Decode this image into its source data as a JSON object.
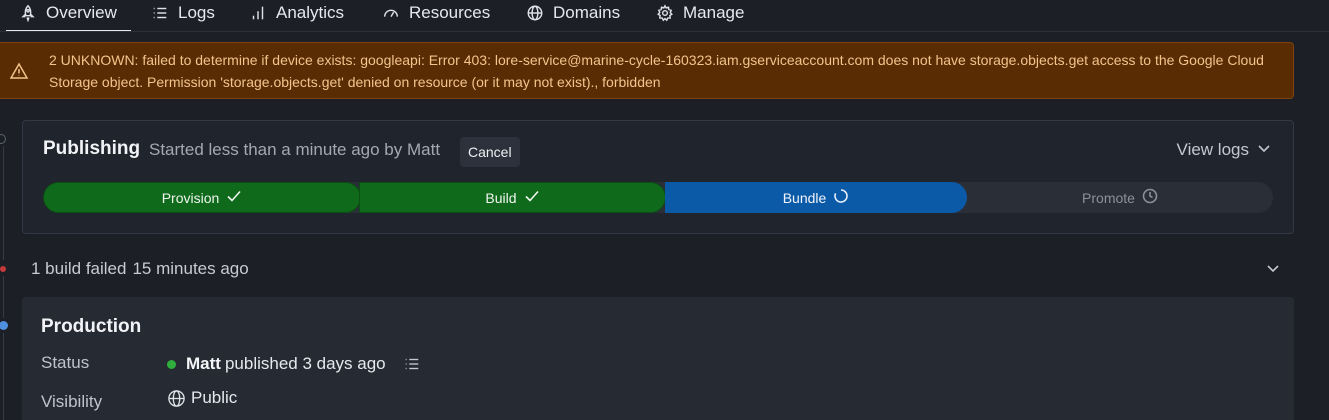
{
  "nav": {
    "tabs": [
      {
        "label": "Overview",
        "icon": "rocket-icon",
        "active": true
      },
      {
        "label": "Logs",
        "icon": "list-icon"
      },
      {
        "label": "Analytics",
        "icon": "bar-chart-icon"
      },
      {
        "label": "Resources",
        "icon": "gauge-icon"
      },
      {
        "label": "Domains",
        "icon": "globe-icon"
      },
      {
        "label": "Manage",
        "icon": "gear-icon"
      }
    ]
  },
  "banner": {
    "icon": "warning-icon",
    "message": "2 UNKNOWN: failed to determine if device exists: googleapi: Error 403: lore-service@marine-cycle-160323.iam.gserviceaccount.com does not have storage.objects.get access to the Google Cloud Storage object. Permission 'storage.objects.get' denied on resource (or it may not exist)., forbidden",
    "background": "#5a2c04",
    "text_color": "#f3c48c"
  },
  "publishing": {
    "title": "Publishing",
    "subtitle": "Started less than a minute ago by Matt",
    "cancel_label": "Cancel",
    "view_logs_label": "View logs",
    "steps": [
      {
        "label": "Provision",
        "state": "done"
      },
      {
        "label": "Build",
        "state": "done"
      },
      {
        "label": "Bundle",
        "state": "running"
      },
      {
        "label": "Promote",
        "state": "pending"
      }
    ]
  },
  "build_failed": {
    "label": "1 build failed",
    "time": "15 minutes ago"
  },
  "production": {
    "title": "Production",
    "status_label": "Status",
    "status_user": "Matt",
    "status_text": "published 3 days ago",
    "visibility_label": "Visibility",
    "visibility_value": "Public"
  },
  "colors": {
    "done": "#0f6b1b",
    "running": "#0b5aa8",
    "pending": "#2a2e37",
    "status_ok": "#2fae3c",
    "timeline_failed": "#c43a3a",
    "timeline_current": "#4f8fe0"
  }
}
